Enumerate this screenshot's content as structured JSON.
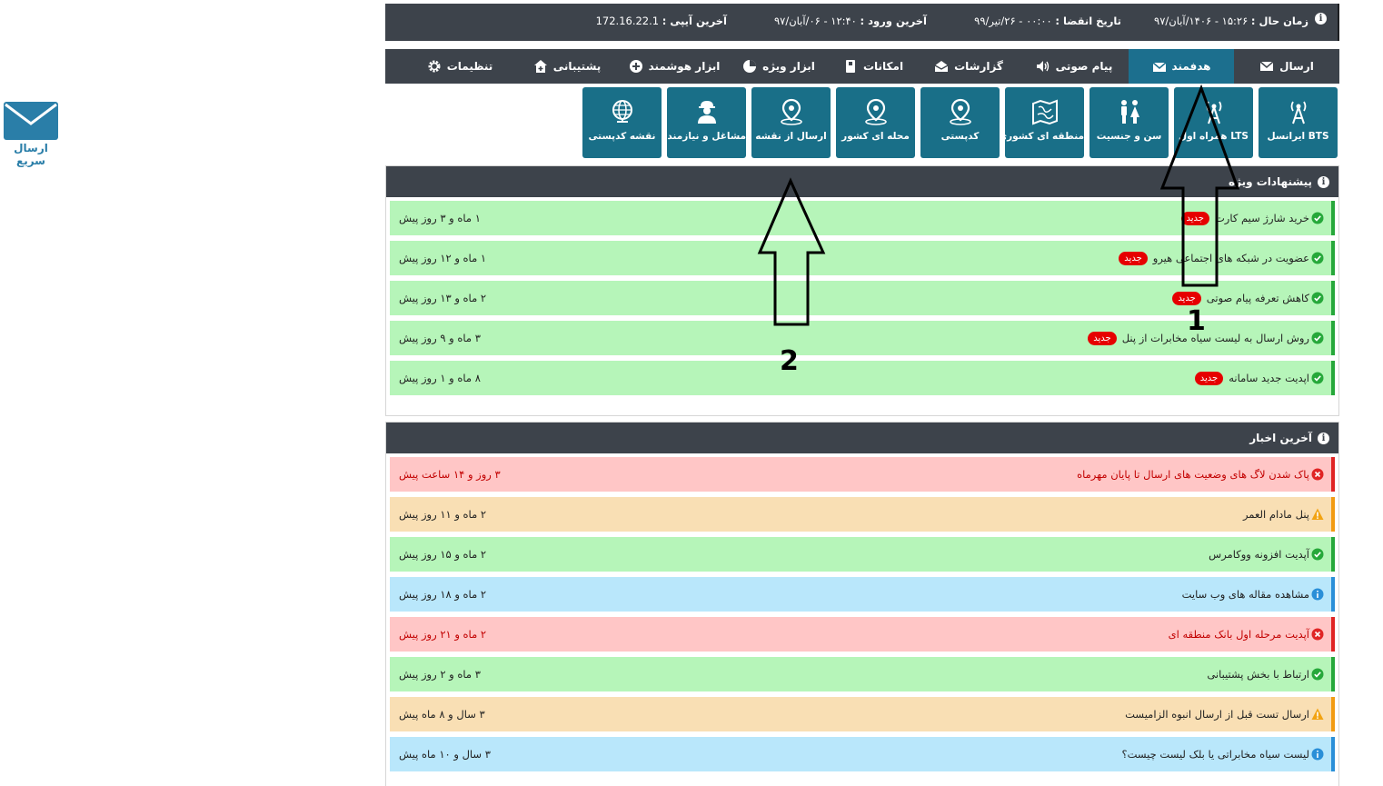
{
  "quick_send": {
    "label": "ارسال سریع",
    "icon": "envelope-icon"
  },
  "top_bar": {
    "current_time": {
      "label": "زمان حال :",
      "value": "۱۵:۲۶ - ۱۴۰۶/آبان/۹۷"
    },
    "expiry": {
      "label": "تاریخ انقضا :",
      "value": "۰۰:۰۰ - ۲۶/تیر/۹۹"
    },
    "last_login": {
      "label": "آخرین ورود :",
      "value": "۱۲:۴۰ - ۰۶/آبان/۹۷"
    },
    "last_ip": {
      "label": "آخرین آیپی :",
      "value": "172.16.22.1"
    }
  },
  "menu": [
    {
      "label": "ارسال",
      "icon": "envelope-icon"
    },
    {
      "label": "هدفمند",
      "icon": "envelope-open-icon",
      "active": true
    },
    {
      "label": "پیام صوتی",
      "icon": "speaker-icon"
    },
    {
      "label": "گزارشات",
      "icon": "inbox-icon"
    },
    {
      "label": "امکانات",
      "icon": "book-icon"
    },
    {
      "label": "ابزار ویژه",
      "icon": "pie-chart-icon"
    },
    {
      "label": "ابزار هوشمند",
      "icon": "plus-circle-icon"
    },
    {
      "label": "پشتیبانی",
      "icon": "home-plus-icon"
    },
    {
      "label": "تنظیمات",
      "icon": "gear-icon"
    }
  ],
  "tiles": [
    {
      "label": "BTS ایرانسل",
      "icon": "antenna-icon"
    },
    {
      "label": "LTS همراه اول",
      "icon": "antenna-icon"
    },
    {
      "label": "سن و جنسیت",
      "icon": "people-icon"
    },
    {
      "label": "منطقه ای کشوری",
      "icon": "map-icon"
    },
    {
      "label": "کدپستی",
      "icon": "map-pin-icon"
    },
    {
      "label": "محله ای کشور",
      "icon": "map-pin-icon"
    },
    {
      "label": "ارسال از نقشه",
      "icon": "map-pin-icon"
    },
    {
      "label": "مشاغل و نیازمندی",
      "icon": "worker-icon"
    },
    {
      "label": "نقشه کدپستی",
      "icon": "globe-icon"
    }
  ],
  "suggestions": {
    "title": "پیشنهادات ویژه",
    "badge": "جدید",
    "items": [
      {
        "text": "خرید شارژ سیم کارت",
        "time": "۱ ماه و ۳ روز پیش"
      },
      {
        "text": "عضویت در شبکه های اجتماعی هیرو",
        "time": "۱ ماه و ۱۲ روز پیش"
      },
      {
        "text": "کاهش تعرفه پیام صوتی",
        "time": "۲ ماه و ۱۳ روز پیش"
      },
      {
        "text": "روش ارسال به لیست سیاه مخابرات از پنل",
        "time": "۳ ماه و ۹ روز پیش"
      },
      {
        "text": "اپدیت جدید سامانه",
        "time": "۸ ماه و ۱ روز پیش"
      }
    ]
  },
  "news": {
    "title": "آخرین اخبار",
    "items": [
      {
        "text": "پاک شدن لاگ های وضعیت های ارسال تا پایان مهرماه",
        "time": "۳ روز و ۱۴ ساعت پیش",
        "status": "red"
      },
      {
        "text": "پنل مادام العمر",
        "time": "۲ ماه و ۱۱ روز پیش",
        "status": "orange"
      },
      {
        "text": "آپدیت افزونه ووکامرس",
        "time": "۲ ماه و ۱۵ روز پیش",
        "status": "green"
      },
      {
        "text": "مشاهده مقاله های وب سایت",
        "time": "۲ ماه و ۱۸ روز پیش",
        "status": "blue"
      },
      {
        "text": "آپدیت مرحله اول بانک منطقه ای",
        "time": "۲ ماه و ۲۱ روز پیش",
        "status": "red"
      },
      {
        "text": "ارتباط با بخش پشتیبانی",
        "time": "۳ ماه و ۲ روز پیش",
        "status": "green"
      },
      {
        "text": "ارسال تست قبل از ارسال انبوه الزامیست",
        "time": "۳ سال و ۸ ماه پیش",
        "status": "orange"
      },
      {
        "text": "لیست سیاه مخابراتی یا بلک لیست چیست؟",
        "time": "۳ سال و ۱۰ ماه پیش",
        "status": "blue"
      }
    ]
  },
  "annotations": [
    {
      "number": "1"
    },
    {
      "number": "2"
    }
  ]
}
